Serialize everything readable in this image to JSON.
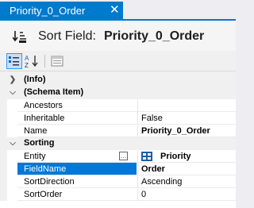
{
  "tab": {
    "title": "Priority_0_Order",
    "close_glyph": "✕"
  },
  "header": {
    "prefix": "Sort Field:",
    "name": "Priority_0_Order",
    "icon": "sort-field-icon"
  },
  "toolbar": {
    "categorized_icon": "categorized-view-icon",
    "alphabetical_icon": "alphabetical-sort-icon",
    "pages_icon": "property-pages-icon"
  },
  "grid": {
    "categories": [
      {
        "label": "(Info)",
        "expanded": false
      },
      {
        "label": "(Schema Item)",
        "expanded": true
      },
      {
        "label": "Sorting",
        "expanded": true
      }
    ],
    "schema_item": [
      {
        "name": "Ancestors",
        "value": ""
      },
      {
        "name": "Inheritable",
        "value": "False"
      },
      {
        "name": "Name",
        "value": "Priority_0_Order"
      }
    ],
    "sorting": [
      {
        "name": "Entity",
        "value": "Priority"
      },
      {
        "name": "FieldName",
        "value": "Order"
      },
      {
        "name": "SortDirection",
        "value": "Ascending"
      },
      {
        "name": "SortOrder",
        "value": "0"
      }
    ],
    "entity_button_glyph": "…",
    "selected_property": "FieldName"
  },
  "colors": {
    "accent": "#007acc",
    "selection": "#0078d7"
  }
}
